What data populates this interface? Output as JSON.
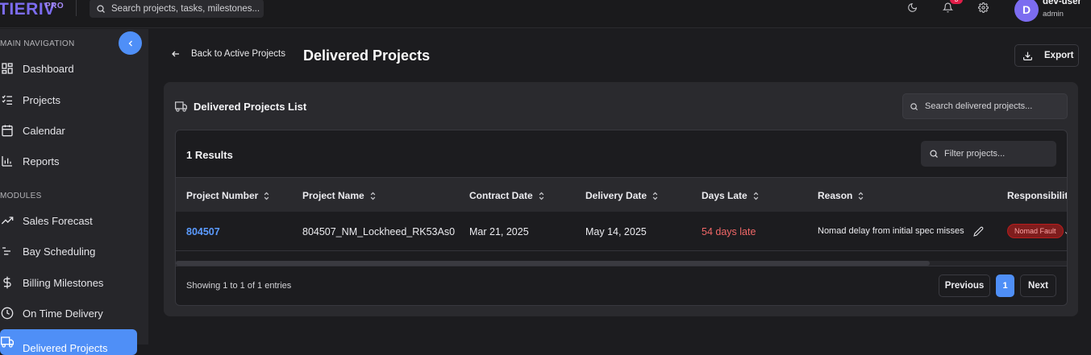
{
  "header": {
    "brand": "TIERIV",
    "brand_suffix": "PRO",
    "search_placeholder": "Search projects, tasks, milestones...",
    "notification_count": "3",
    "user": {
      "initial": "D",
      "name": "dev-user",
      "role": "admin"
    }
  },
  "sidebar": {
    "main_nav_label": "MAIN NAVIGATION",
    "main_items": [
      {
        "label": "Dashboard",
        "icon": "grid-icon"
      },
      {
        "label": "Projects",
        "icon": "checklist-icon"
      },
      {
        "label": "Calendar",
        "icon": "calendar-icon"
      },
      {
        "label": "Reports",
        "icon": "bar-chart-icon"
      }
    ],
    "modules_label": "MODULES",
    "module_items": [
      {
        "label": "Sales Forecast",
        "icon": "trending-up-icon"
      },
      {
        "label": "Bay Scheduling",
        "icon": "list-filter-icon"
      },
      {
        "label": "Billing Milestones",
        "icon": "dollar-icon"
      },
      {
        "label": "On Time Delivery",
        "icon": "clock-icon"
      },
      {
        "label": "Delivered Projects",
        "icon": "truck-icon",
        "active": true
      }
    ]
  },
  "page": {
    "back_label": "Back to Active Projects",
    "title": "Delivered Projects",
    "export_label": "Export"
  },
  "card": {
    "title": "Delivered Projects List",
    "search_placeholder": "Search delivered projects...",
    "results_label": "1 Results",
    "filter_placeholder": "Filter projects...",
    "columns": [
      "Project Number",
      "Project Name",
      "Contract Date",
      "Delivery Date",
      "Days Late",
      "Reason",
      "Responsibility"
    ],
    "rows": [
      {
        "project_number": "804507",
        "project_name": "804507_NM_Lockheed_RK53As0",
        "contract_date": "Mar 21, 2025",
        "delivery_date": "May 14, 2025",
        "days_late": "54 days late",
        "reason": "Nomad delay from initial spec misses",
        "responsibility": "Nomad Fault"
      }
    ],
    "showing_text": "Showing 1 to 1 of 1 entries",
    "pagination": {
      "previous": "Previous",
      "current": "1",
      "next": "Next"
    }
  },
  "colors": {
    "accent": "#4f8ff7",
    "late": "#f06767",
    "badge_bg": "#7f1d1d"
  }
}
